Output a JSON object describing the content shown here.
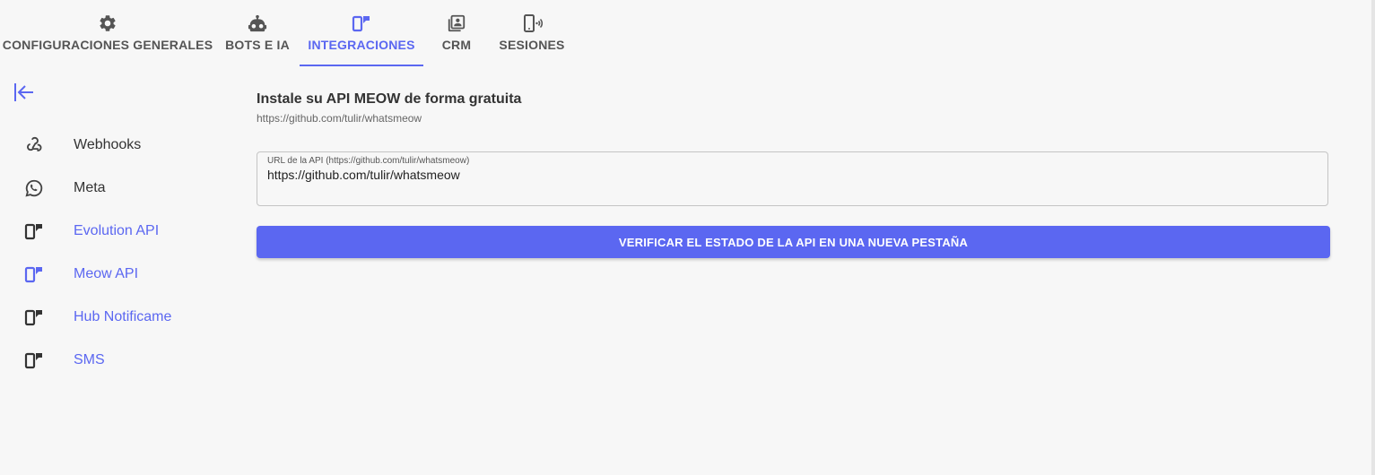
{
  "colors": {
    "accent": "#5b67f1",
    "text": "#333333",
    "background": "#f7f7f7"
  },
  "tabs": [
    {
      "label": "CONFIGURACIONES GENERALES",
      "icon": "gear-icon",
      "active": false
    },
    {
      "label": "BOTS E IA",
      "icon": "robot-icon",
      "active": false
    },
    {
      "label": "INTEGRACIONES",
      "icon": "devices-icon",
      "active": true
    },
    {
      "label": "CRM",
      "icon": "contacts-icon",
      "active": false
    },
    {
      "label": "SESIONES",
      "icon": "phone-signal-icon",
      "active": false
    }
  ],
  "sidebar": {
    "collapse_icon": "arrow-left-to-bar-icon",
    "items": [
      {
        "label": "Webhooks",
        "icon": "webhook-icon"
      },
      {
        "label": "Meta",
        "icon": "whatsapp-icon"
      },
      {
        "label": "Evolution API",
        "icon": "devices-icon"
      },
      {
        "label": "Meow API",
        "icon": "devices-icon",
        "active": true
      },
      {
        "label": "Hub Notificame",
        "icon": "devices-icon"
      },
      {
        "label": "SMS",
        "icon": "devices-icon"
      }
    ]
  },
  "main": {
    "title": "Instale su API MEOW de forma gratuita",
    "subtitle": "https://github.com/tulir/whatsmeow",
    "url_field": {
      "label": "URL de la API (https://github.com/tulir/whatsmeow)",
      "value": "https://github.com/tulir/whatsmeow"
    },
    "verify_button": "VERIFICAR EL ESTADO DE LA API EN UNA NUEVA PESTAÑA"
  }
}
